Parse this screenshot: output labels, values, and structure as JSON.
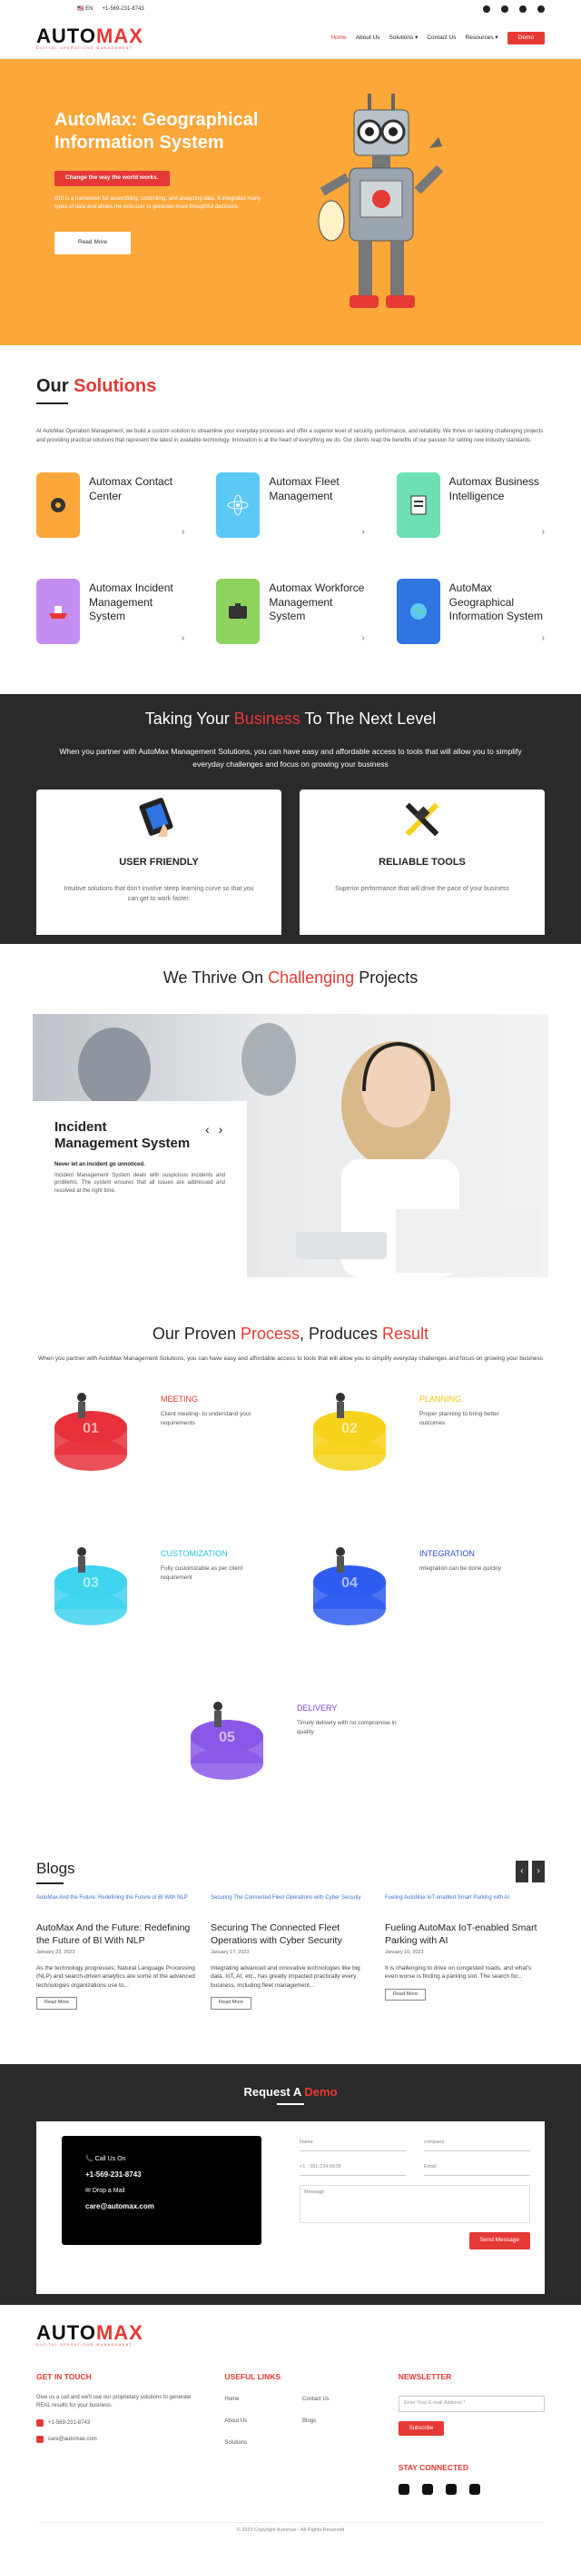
{
  "topbar": {
    "lang": "EN",
    "phone": "+1-569-231-8743",
    "social": [
      "facebook-icon",
      "twitter-icon",
      "linkedin-icon",
      "youtube-icon"
    ]
  },
  "brand": {
    "word_a": "AUTO",
    "word_b": "MAX",
    "tagline": "DIGITAL OPERATIONS MANAGEMENT"
  },
  "nav": {
    "items": [
      "Home",
      "About Us",
      "Solutions ▾",
      "Contact Us",
      "Resources ▾"
    ],
    "demo": "Demo"
  },
  "hero": {
    "title": "AutoMax: Geographical Information System",
    "subtitle": "Change the way the world works.",
    "desc": "GIS is a framework for assembling, controlling, and analyzing data. It integrates many types of data and allows the end-user to generate more thoughtful decisions.",
    "button": "Read More"
  },
  "solutions": {
    "title_a": "Our ",
    "title_b": "Solutions",
    "desc": "At AutoMax Operation Management, we build a custom solution to streamline your everyday processes and offer a superior level of security, performance, and reliability. We thrive on tackling challenging projects and providing practical solutions that represent the latest in available technology. Innovation is at the heart of everything we do. Our clients reap the benefits of our passion for setting new industry standards.",
    "items": [
      {
        "title": "Automax Contact Center",
        "color": "#fba73a"
      },
      {
        "title": "Automax Fleet Management",
        "color": "#5cc9f5"
      },
      {
        "title": "Automax Business Intelligence",
        "color": "#6ee0b4"
      },
      {
        "title": "Automax Incident Management System",
        "color": "#c48ef0"
      },
      {
        "title": "Automax Workforce Management System",
        "color": "#8fd35f"
      },
      {
        "title": "AutoMax Geographical Information System",
        "color": "#2f74e0"
      }
    ]
  },
  "level": {
    "t1": "Taking Your ",
    "t2": "Business",
    "t3": " To The Next Level",
    "desc": "When you partner with AutoMax Management Solutions, you can have easy and affordable access to tools that will allow you to simplify everyday challenges and focus on growing your business",
    "features": [
      {
        "title": "USER FRIENDLY",
        "desc": "Intuitive solutions that don't involve steep learning curve so that you can get to work faster."
      },
      {
        "title": "RELIABLE TOOLS",
        "desc": "Superior performance that will drive the pace of your business"
      }
    ]
  },
  "thrive": {
    "t1": "We Thrive On ",
    "t2": "Challenging",
    "t3": " Projects",
    "slide": {
      "title": "Incident Management System",
      "bold": "Never let an incident go unnoticed.",
      "text": "Incident Management System deals with suspicious incidents and problems. The system ensures that all issues are addressed and resolved at the right time."
    }
  },
  "process": {
    "t1": "Our Proven ",
    "t2": "Process",
    "t3": ", Produces ",
    "t4": "Result",
    "intro": "When you partner with AutoMax Management Solutions, you can have easy and affordable access to tools that will allow you to simplify everyday challenges and focus on growing your business",
    "steps": [
      {
        "num": "01",
        "label": "MEETING",
        "text": "Client meeting- to understand your requirements",
        "color": "#e8303a",
        "lcolor": "#e63935"
      },
      {
        "num": "02",
        "label": "PLANNING",
        "text": "Proper planning to bring better outcomes",
        "color": "#f6d21a",
        "lcolor": "#f2c40f"
      },
      {
        "num": "03",
        "label": "CUSTOMIZATION",
        "text": "Fully customizable as per client requirement",
        "color": "#3ed4ee",
        "lcolor": "#27c4e0"
      },
      {
        "num": "04",
        "label": "INTEGRATION",
        "text": "Integration can be done quickly",
        "color": "#2f5cf0",
        "lcolor": "#2f4fcf"
      },
      {
        "num": "05",
        "label": "DELIVERY",
        "text": "Timely delivery with no compromise in quality",
        "color": "#8a58e8",
        "lcolor": "#7a48d8"
      }
    ]
  },
  "blogs": {
    "title": "Blogs",
    "posts": [
      {
        "img": "AutoMax And the Future: Redefining the Future of BI With NLP",
        "title": "AutoMax And the Future: Redefining the Future of BI With NLP",
        "date": "January 23, 2023",
        "excerpt": "As the technology progresses, Natural Language Processing (NLP) and search-driven analytics are some of the advanced technologies organizations use to...",
        "more": "Read More"
      },
      {
        "img": "Securing The Connected Fleet Operations with Cyber Security",
        "title": "Securing The Connected Fleet Operations with Cyber Security",
        "date": "January 17, 2023",
        "excerpt": "Integrating advanced and innovative technologies like big data, IoT, AI, etc., has greatly impacted practically every business, including fleet management...",
        "more": "Read More"
      },
      {
        "img": "Fueling AutoMax IoT-enabled Smart Parking with AI",
        "title": "Fueling AutoMax IoT-enabled Smart Parking with AI",
        "date": "January 10, 2023",
        "excerpt": "It is challenging to drive on congested roads, and what's even worse is finding a parking slot. The search for...",
        "more": "Read More"
      }
    ]
  },
  "request": {
    "t1": "Request A ",
    "t2": "Demo",
    "call": "Call Us On",
    "phone": "+1-569-231-8743",
    "mail_label": "Drop a Mail",
    "mail": "care@automax.com",
    "fields": {
      "name": "Name",
      "company": "company",
      "phone": "+1 · 201-234-5678",
      "email": "Email",
      "message": "Message"
    },
    "send": "Send Message"
  },
  "footer": {
    "touch": "GET IN TOUCH",
    "touch_desc": "Give us a call and we'll use our proprietary solutions to generate REAL results for your business.",
    "phone": "+1-569-231-8743",
    "email": "care@automax.com",
    "links_title": "USEFUL LINKS",
    "links": [
      "Home",
      "Contact Us",
      "About Us",
      "Blogs",
      "Solutions"
    ],
    "newsletter": "NEWSLETTER",
    "nl_placeholder": "Enter Your E-mail Address *",
    "subscribe": "Subscribe",
    "stay": "STAY CONNECTED",
    "copyright": "© 2023 Copyright Automax - All Rights Reserved"
  }
}
